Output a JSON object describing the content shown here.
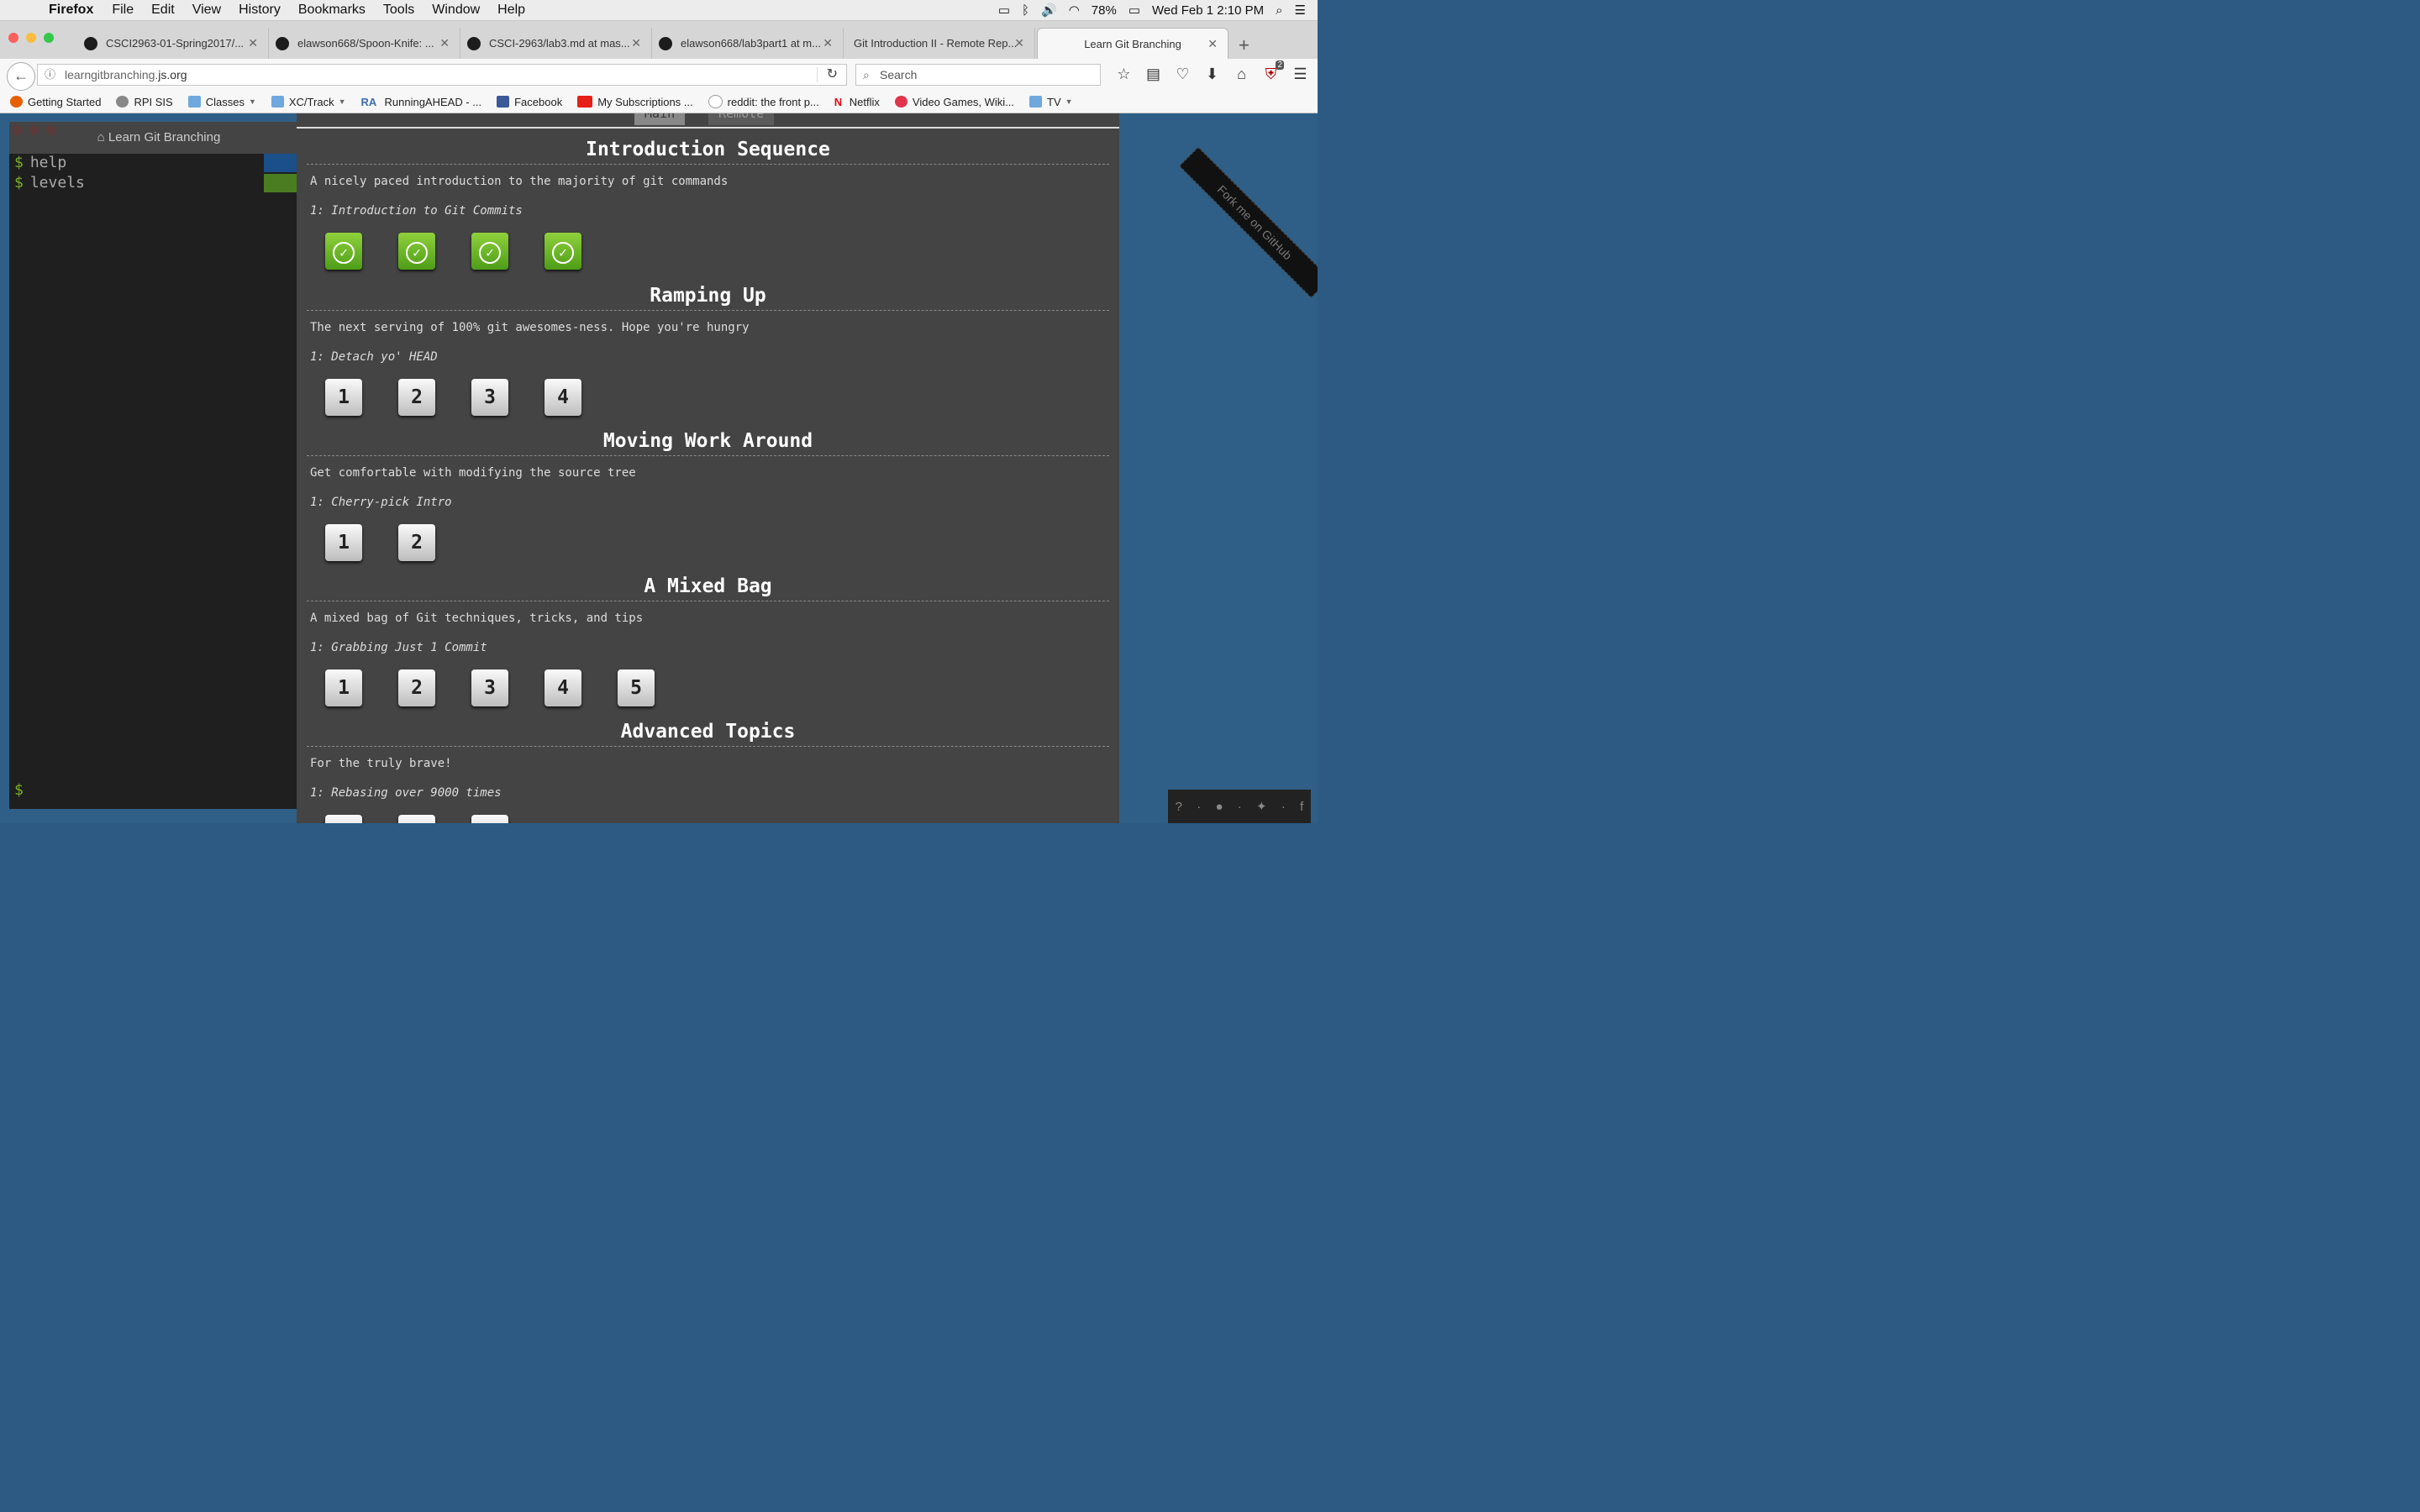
{
  "menubar": {
    "apple": "",
    "app": "Firefox",
    "items": [
      "File",
      "Edit",
      "View",
      "History",
      "Bookmarks",
      "Tools",
      "Window",
      "Help"
    ],
    "battery": "78%",
    "datetime": "Wed Feb 1  2:10 PM"
  },
  "tabs": [
    {
      "title": "CSCI2963-01-Spring2017/...",
      "favicon": "github-icon"
    },
    {
      "title": "elawson668/Spoon-Knife: ...",
      "favicon": "github-icon"
    },
    {
      "title": "CSCI-2963/lab3.md at mas...",
      "favicon": "github-icon"
    },
    {
      "title": "elawson668/lab3part1 at m...",
      "favicon": "github-icon"
    },
    {
      "title": "Git Introduction II - Remote Rep...",
      "favicon": ""
    },
    {
      "title": "Learn Git Branching",
      "favicon": "",
      "active": true
    }
  ],
  "nav": {
    "url_plain": "learngitbranching.",
    "url_domain": "js.org",
    "search_placeholder": "Search",
    "badge": "2"
  },
  "bookmarks": [
    {
      "label": "Getting Started",
      "icon": "firefox-icon",
      "color": "#e66000"
    },
    {
      "label": "RPI SIS",
      "icon": "globe-icon",
      "color": "#888888"
    },
    {
      "label": "Classes",
      "icon": "folder-icon",
      "color": "#6fa8dc",
      "menu": true
    },
    {
      "label": "XC/Track",
      "icon": "folder-icon",
      "color": "#6fa8dc",
      "menu": true
    },
    {
      "label": "RunningAHEAD - ...",
      "icon": "ra-icon",
      "color": "#3a6fb0"
    },
    {
      "label": "Facebook",
      "icon": "facebook-icon",
      "color": "#3b5998"
    },
    {
      "label": "My Subscriptions ...",
      "icon": "youtube-icon",
      "color": "#e62117"
    },
    {
      "label": "reddit: the front p...",
      "icon": "reddit-icon",
      "color": "#ff4500"
    },
    {
      "label": "Netflix",
      "icon": "netflix-icon",
      "color": "#e50914"
    },
    {
      "label": "Video Games, Wiki...",
      "icon": "wikia-icon",
      "color": "#e2334b"
    },
    {
      "label": "TV",
      "icon": "folder-icon",
      "color": "#6fa8dc",
      "menu": true
    }
  ],
  "terminal": {
    "title": "Learn Git Branching",
    "lines": [
      "help",
      "levels"
    ],
    "prompt": "$"
  },
  "dialog": {
    "tabs": [
      "Main",
      "Remote"
    ],
    "sections": [
      {
        "title": "Introduction Sequence",
        "about": "A nicely paced introduction to the majority of git commands",
        "level": "1: Introduction to Git Commits",
        "buttons": [
          "",
          "",
          "",
          ""
        ],
        "done": true
      },
      {
        "title": "Ramping Up",
        "about": "The next serving of 100% git awesomes-ness. Hope you're hungry",
        "level": "1: Detach yo' HEAD",
        "buttons": [
          "1",
          "2",
          "3",
          "4"
        ],
        "done": false
      },
      {
        "title": "Moving Work Around",
        "about": "Get comfortable with modifying the source tree",
        "level": "1: Cherry-pick Intro",
        "buttons": [
          "1",
          "2"
        ],
        "done": false
      },
      {
        "title": "A Mixed Bag",
        "about": "A mixed bag of Git techniques, tricks, and tips",
        "level": "1: Grabbing Just 1 Commit",
        "buttons": [
          "1",
          "2",
          "3",
          "4",
          "5"
        ],
        "done": false
      },
      {
        "title": "Advanced Topics",
        "about": "For the truly brave!",
        "level": "1: Rebasing over 9000 times",
        "buttons": [],
        "done": false
      }
    ]
  },
  "ribbon": "Fork me on GitHub"
}
